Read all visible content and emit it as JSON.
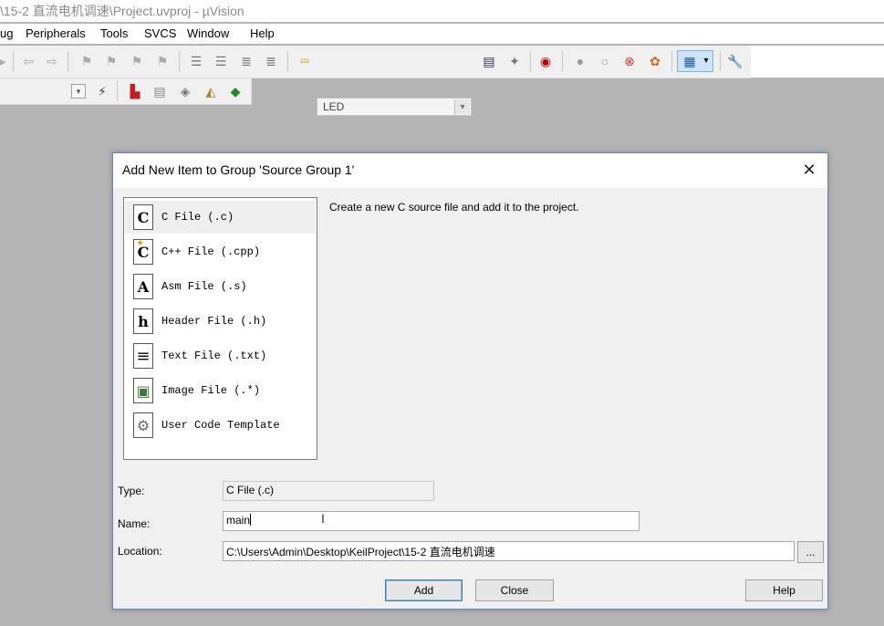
{
  "window": {
    "title": "\\15-2 直流电机调速\\Project.uvproj - µVision"
  },
  "menu": [
    "ug",
    "Peripherals",
    "Tools",
    "SVCS",
    "Window",
    "Help"
  ],
  "toolbar": {
    "target": "LED",
    "dropdown_glyph": "▾"
  },
  "dialog": {
    "title": "Add New Item to Group 'Source Group 1'",
    "close_glyph": "✕",
    "description": "Create a new C source file and add it to the project.",
    "items": [
      {
        "label": "C File (.c)",
        "icon": "c-file-icon",
        "glyph": "C"
      },
      {
        "label": "C++ File (.cpp)",
        "icon": "cpp-file-icon",
        "glyph": "C"
      },
      {
        "label": "Asm File (.s)",
        "icon": "asm-file-icon",
        "glyph": "A"
      },
      {
        "label": "Header File (.h)",
        "icon": "header-file-icon",
        "glyph": "h"
      },
      {
        "label": "Text File (.txt)",
        "icon": "text-file-icon",
        "glyph": "≡"
      },
      {
        "label": "Image File (.*)",
        "icon": "image-file-icon",
        "glyph": "▣"
      },
      {
        "label": "User Code Template",
        "icon": "code-template-icon",
        "glyph": "⚙"
      }
    ],
    "selected_index": 0,
    "type_label": "Type:",
    "type_value": "C File (.c)",
    "name_label": "Name:",
    "name_value": "main",
    "location_label": "Location:",
    "location_value": "C:\\Users\\Admin\\Desktop\\KeilProject\\15-2 直流电机调速",
    "browse_label": "...",
    "add_button": "Add",
    "close_button": "Close",
    "help_button": "Help"
  }
}
